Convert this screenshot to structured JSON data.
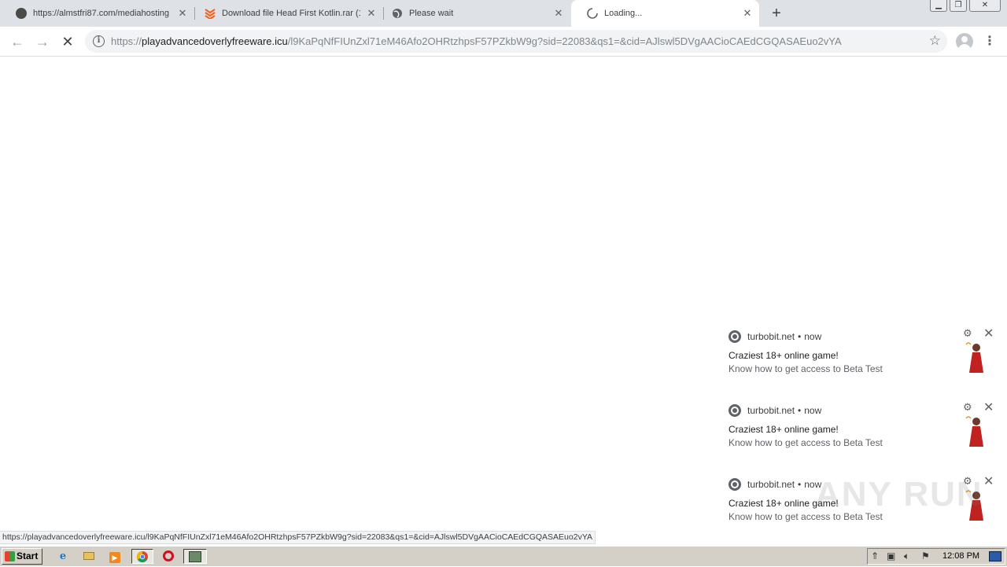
{
  "tabs": [
    {
      "title": "https://almstfri87.com/mediahosting",
      "icon": "globe-dark-icon"
    },
    {
      "title": "Download file Head First Kotlin.rar (1",
      "icon": "turbobit-icon"
    },
    {
      "title": "Please wait",
      "icon": "globe-icon"
    },
    {
      "title": "Loading...",
      "icon": "spinner-icon"
    }
  ],
  "omnibox": {
    "scheme": "https://",
    "host": "playadvancedoverlyfreeware.icu",
    "path": "/l9KaPqNfFIUnZxl71eM46Afo2OHRtzhpsF57PZkbW9g?sid=22083&qs1=&cid=AJlswl5DVgAACioCAEdCGQASAEuo2vYA"
  },
  "notifications": [
    {
      "source": "turbobit.net",
      "time": "now",
      "title": "Craziest 18+ online game!",
      "body": "Know how to get access to Beta Test"
    },
    {
      "source": "turbobit.net",
      "time": "now",
      "title": "Craziest 18+ online game!",
      "body": "Know how to get access to Beta Test"
    },
    {
      "source": "turbobit.net",
      "time": "now",
      "title": "Craziest 18+ online game!",
      "body": "Know how to get access to Beta Test"
    }
  ],
  "status_url": "https://playadvancedoverlyfreeware.icu/l9KaPqNfFIUnZxl71eM46Afo2OHRtzhpsF57PZkbW9g?sid=22083&qs1=&cid=AJlswl5DVgAACioCAEdCGQASAEuo2vYA",
  "watermark": "ANY RUN",
  "taskbar": {
    "start_label": "Start",
    "clock": "12:08 PM"
  }
}
